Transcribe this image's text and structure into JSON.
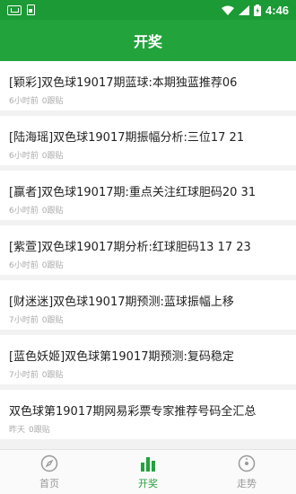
{
  "status_bar": {
    "time": "4:46"
  },
  "header": {
    "title": "开奖"
  },
  "items": [
    {
      "title": "[颖彩]双色球19017期蓝球:本期独蓝推荐06",
      "time": "6小时前",
      "replies": "0跟贴"
    },
    {
      "title": "[陆海瑶]双色球19017期振幅分析:三位17 21",
      "time": "6小时前",
      "replies": "0跟贴"
    },
    {
      "title": "[赢者]双色球19017期:重点关注红球胆码20 31",
      "time": "6小时前",
      "replies": "0跟贴"
    },
    {
      "title": "[紫萱]双色球19017期分析:红球胆码13 17 23",
      "time": "6小时前",
      "replies": "0跟贴"
    },
    {
      "title": "[财迷迷]双色球19017期预测:蓝球振幅上移",
      "time": "7小时前",
      "replies": "0跟贴"
    },
    {
      "title": "[蓝色妖姬]双色球第19017期预测:复码稳定",
      "time": "7小时前",
      "replies": "0跟贴"
    },
    {
      "title": "双色球第19017期网易彩票专家推荐号码全汇总",
      "time": "昨天",
      "replies": "0跟贴"
    }
  ],
  "tabs": [
    {
      "label": "首页",
      "icon": "compass-icon"
    },
    {
      "label": "开奖",
      "icon": "bar-chart-icon"
    },
    {
      "label": "走势",
      "icon": "trend-icon"
    }
  ],
  "colors": {
    "status_bar": "#1b9a35",
    "header": "#22a33c",
    "active_tab": "#22a33c",
    "inactive_tab": "#999999"
  }
}
